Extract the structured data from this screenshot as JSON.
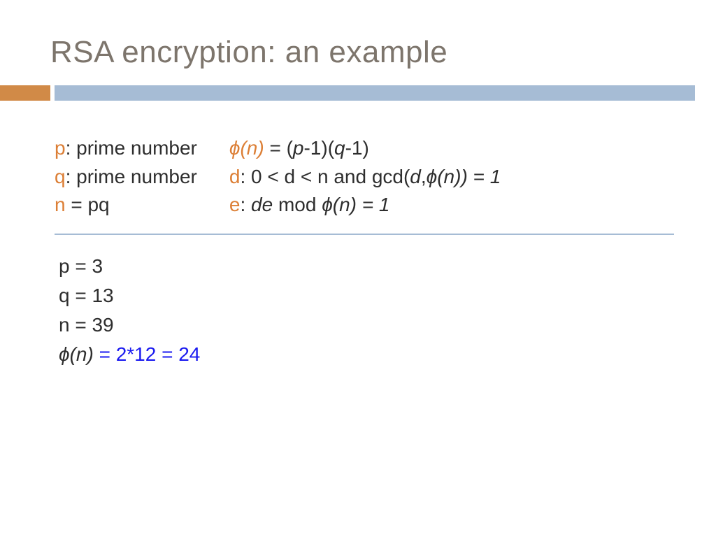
{
  "title": "RSA encryption: an example",
  "colors": {
    "title_gray": "#7d756c",
    "accent_orange": "#dc7f36",
    "bar_orange": "#d18a47",
    "bar_blue": "#a6bcd5",
    "link_blue": "#1a1af0"
  },
  "defs": {
    "left": {
      "p": {
        "sym": "p",
        "rest": ": prime number"
      },
      "q": {
        "sym": "q",
        "rest": ": prime number"
      },
      "n": {
        "sym": "n",
        "rest": "  = pq"
      }
    },
    "right": {
      "phi": {
        "sym": "ɸ(n)",
        "rest1": " = (",
        "p": "p",
        "mid": "-1)(",
        "q": "q",
        "rest2": "-1)"
      },
      "d": {
        "sym": "d",
        "colon": ":   ",
        "rest1": "0 < d < n and gcd(",
        "dvar": "d",
        "comma": ",",
        "phin": "ɸ(n)",
        "rest2": ") = ",
        "one": "1"
      },
      "e": {
        "sym": "e",
        "colon": ":   ",
        "de": "de",
        "mid": " mod ",
        "phin": "ɸ(n) = 1"
      }
    }
  },
  "example": {
    "p": "p = 3",
    "q": "q = 13",
    "n": "n = 39",
    "phi": {
      "lhs": "ɸ(n)",
      "rhs": " = 2*12 = 24"
    }
  }
}
